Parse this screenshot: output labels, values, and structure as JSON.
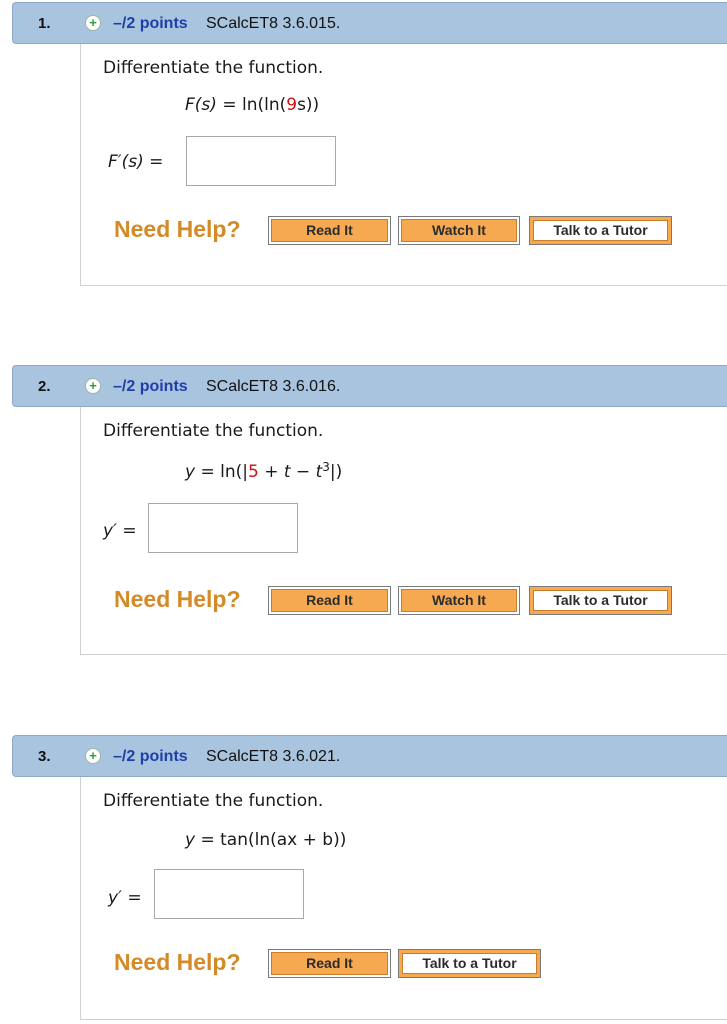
{
  "questions": [
    {
      "number": "1.",
      "points": "–/2 points",
      "code": "SCalcET8 3.6.015.",
      "prompt": "Differentiate the function.",
      "equation": {
        "lhs": "F(s)",
        "eq": "=",
        "pre": "ln(ln(",
        "red": "9",
        "post": "s))"
      },
      "answer_label": "F′(s) =",
      "answer_value": "",
      "help_label": "Need Help?",
      "buttons": [
        "Read It",
        "Watch It",
        "Talk to a Tutor"
      ]
    },
    {
      "number": "2.",
      "points": "–/2 points",
      "code": "SCalcET8 3.6.016.",
      "prompt": "Differentiate the function.",
      "equation": {
        "lhs": "y",
        "eq": "=",
        "pre": "ln(|",
        "red": "5",
        "post": " + t − t",
        "sup": "3",
        "end": "|)"
      },
      "answer_label": "y′ =",
      "answer_value": "",
      "help_label": "Need Help?",
      "buttons": [
        "Read It",
        "Watch It",
        "Talk to a Tutor"
      ]
    },
    {
      "number": "3.",
      "points": "–/2 points",
      "code": "SCalcET8 3.6.021.",
      "prompt": "Differentiate the function.",
      "equation": {
        "lhs": "y",
        "eq": "=",
        "pre": "tan(ln(ax + b))"
      },
      "answer_label": "y′ =",
      "answer_value": "",
      "help_label": "Need Help?",
      "buttons": [
        "Read It",
        "Talk to a Tutor"
      ]
    }
  ],
  "colors": {
    "header_bg": "#a9c4de",
    "points_blue": "#1f3fa8",
    "help_orange": "#d48a26",
    "button_orange": "#f6a951",
    "highlight_red": "#cc1111"
  },
  "icons": {
    "expand": "plus-circle-icon"
  }
}
